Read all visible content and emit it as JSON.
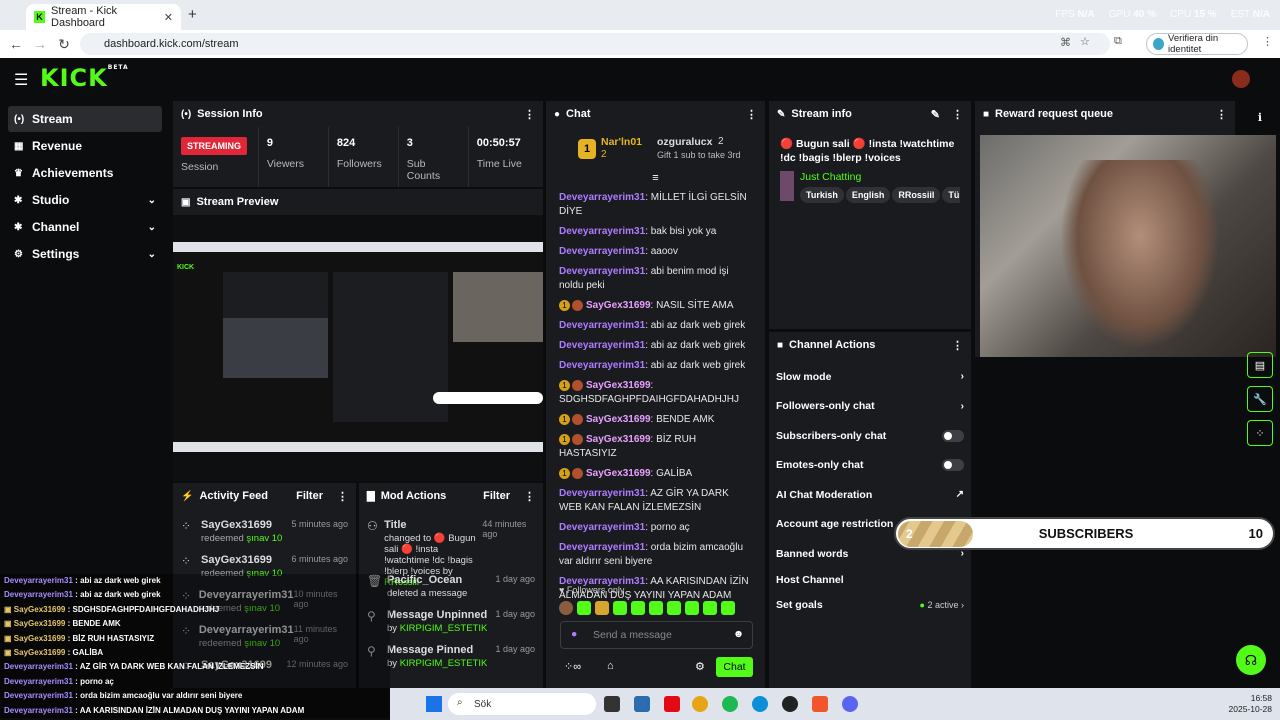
{
  "browser": {
    "tab_title": "Stream - Kick Dashboard",
    "url": "dashboard.kick.com/stream",
    "verify_label": "Verifiera din identitet",
    "perf": {
      "fps_label": "FPS",
      "fps": "N/A",
      "gpu_label": "GPU",
      "gpu": "40 %",
      "cpu_label": "CPU",
      "cpu": "15 %",
      "est_label": "EST",
      "est": "N/A"
    }
  },
  "kick": {
    "logo": "KICK",
    "logo_sup": "BETA"
  },
  "sidebar": {
    "items": [
      {
        "label": "Stream",
        "icon": "(•)"
      },
      {
        "label": "Revenue",
        "icon": "▦"
      },
      {
        "label": "Achievements",
        "icon": "🏆"
      },
      {
        "label": "Studio",
        "icon": "✱"
      },
      {
        "label": "Channel",
        "icon": "✱"
      },
      {
        "label": "Settings",
        "icon": "⚙"
      }
    ]
  },
  "session": {
    "title": "Session Info",
    "status": "STREAMING",
    "status_label": "Session",
    "viewers": "9",
    "viewers_label": "Viewers",
    "followers": "824",
    "followers_label": "Followers",
    "subs": "3",
    "subs_label": "Sub Counts",
    "time": "00:50:57",
    "time_label": "Time Live"
  },
  "preview": {
    "title": "Stream Preview"
  },
  "activity": {
    "title": "Activity Feed",
    "filter": "Filter",
    "items": [
      {
        "name": "SayGex31699",
        "action": "redeemed",
        "reward": "şınav 10",
        "time": "5 minutes ago"
      },
      {
        "name": "SayGex31699",
        "action": "redeemed",
        "reward": "şınav 10",
        "time": "6 minutes ago"
      },
      {
        "name": "Deveyarrayerim31",
        "action": "redeemed",
        "reward": "şınav 10",
        "time": "10 minutes ago"
      },
      {
        "name": "Deveyarrayerim31",
        "action": "redeemed",
        "reward": "şınav 10",
        "time": "11 minutes ago"
      },
      {
        "name": "SayGex31699",
        "action": "",
        "reward": "",
        "time": "12 minutes ago"
      }
    ]
  },
  "mod": {
    "title": "Mod Actions",
    "filter": "Filter",
    "items": [
      {
        "title": "Title",
        "desc": "changed to 🔴 Bugun sali 🔴 !insta !watchtime !dc !bagis !blerp !voices by",
        "by": "RRossiil",
        "time": "44 minutes ago"
      },
      {
        "title": "Pacific_Ocean",
        "desc": "deleted a message",
        "by": "",
        "time": "1 day ago"
      },
      {
        "title": "Message Unpinned",
        "desc": "by",
        "by": "KIRPIGIM_ESTETIK",
        "time": "1 day ago"
      },
      {
        "title": "Message Pinned",
        "desc": "by",
        "by": "KIRPIGIM_ESTETIK",
        "time": "1 day ago"
      }
    ]
  },
  "chat": {
    "title": "Chat",
    "top1_name": "Nar'ln01",
    "top1_count": "2",
    "top2_name": "ozguralucx",
    "top2_count": "2",
    "gift_text": "Gift 1 sub to take 3rd",
    "messages": [
      {
        "user": "Deveyarrayerim31",
        "text": "MİLLET İLGİ GELSİN DİYE",
        "badge": false
      },
      {
        "user": "Deveyarrayerim31",
        "text": "bak bisi yok ya",
        "badge": false
      },
      {
        "user": "Deveyarrayerim31",
        "text": "aaoov",
        "badge": false
      },
      {
        "user": "Deveyarrayerim31",
        "text": "abi benim mod işi noldu peki",
        "badge": false
      },
      {
        "user": "SayGex31699",
        "text": "NASIL SİTE AMA",
        "badge": true
      },
      {
        "user": "Deveyarrayerim31",
        "text": "abi az dark web girek",
        "badge": false
      },
      {
        "user": "Deveyarrayerim31",
        "text": "abi az dark web girek",
        "badge": false
      },
      {
        "user": "Deveyarrayerim31",
        "text": "abi az dark web girek",
        "badge": false
      },
      {
        "user": "SayGex31699",
        "text": "SDGHSDFAGHPFDAIHGFDAHADHJHJ",
        "badge": true
      },
      {
        "user": "SayGex31699",
        "text": "BENDE AMK",
        "badge": true
      },
      {
        "user": "SayGex31699",
        "text": "BİZ RUH HASTASIYIZ",
        "badge": true
      },
      {
        "user": "SayGex31699",
        "text": "GALİBA",
        "badge": true
      },
      {
        "user": "Deveyarrayerim31",
        "text": "AZ GİR YA DARK WEB KAN FALAN İZLEMEZSİN",
        "badge": false
      },
      {
        "user": "Deveyarrayerim31",
        "text": "porno aç",
        "badge": false
      },
      {
        "user": "Deveyarrayerim31",
        "text": "orda bizim amcaoğlu var aldırır seni biyere",
        "badge": false
      },
      {
        "user": "Deveyarrayerim31",
        "text": "AA KARISINDAN İZİN ALMADAN DUŞ YAYINI YAPAN ADAM",
        "badge": false
      }
    ],
    "followers_only": "Followers only",
    "placeholder": "Send a message",
    "send": "Chat"
  },
  "stream_info": {
    "title": "Stream info",
    "stream_title": "🔴 Bugun sali 🔴 !insta !watchtime !dc !bagis !blerp !voices",
    "category": "Just Chatting",
    "tags": [
      "Turkish",
      "English",
      "RRossiil",
      "Türk"
    ]
  },
  "channel_actions": {
    "title": "Channel Actions",
    "items": [
      {
        "label": "Slow mode",
        "ctrl": "chev"
      },
      {
        "label": "Followers-only chat",
        "ctrl": "chev"
      },
      {
        "label": "Subscribers-only chat",
        "ctrl": "toggle"
      },
      {
        "label": "Emotes-only chat",
        "ctrl": "toggle"
      },
      {
        "label": "AI Chat Moderation",
        "ctrl": "ext"
      },
      {
        "label": "Account age restriction",
        "ctrl": ""
      },
      {
        "label": "Banned words",
        "ctrl": "chev"
      },
      {
        "label": "Host Channel",
        "ctrl": ""
      },
      {
        "label": "Set goals",
        "ctrl": "chev"
      }
    ],
    "goals_active": "2 active"
  },
  "reward": {
    "title": "Reward request queue"
  },
  "subs_overlay": {
    "current": "2",
    "label": "SUBSCRIBERS",
    "goal": "10",
    "progress": 0.2
  },
  "ghost": [
    {
      "user": "Deveyarrayerim31",
      "text": "abi az dark web girek",
      "badge": false
    },
    {
      "user": "Deveyarrayerim31",
      "text": "abi az dark web girek",
      "badge": false
    },
    {
      "user": "SayGex31699",
      "text": "SDGHSDFAGHPFDAIHGFDAHADHJHJ",
      "badge": true
    },
    {
      "user": "SayGex31699",
      "text": "BENDE AMK",
      "badge": true
    },
    {
      "user": "SayGex31699",
      "text": "BİZ RUH HASTASIYIZ",
      "badge": true
    },
    {
      "user": "SayGex31699",
      "text": "GALİBA",
      "badge": true
    },
    {
      "user": "Deveyarrayerim31",
      "text": "AZ GİR YA DARK WEB KAN FALAN İZLEMEZSİN",
      "badge": false
    },
    {
      "user": "Deveyarrayerim31",
      "text": "porno aç",
      "badge": false
    },
    {
      "user": "Deveyarrayerim31",
      "text": "orda bizim amcaoğlu var aldırır seni biyere",
      "badge": false
    },
    {
      "user": "Deveyarrayerim31",
      "text": "AA KARISINDAN İZİN ALMADAN DUŞ YAYINI YAPAN ADAM",
      "badge": false
    }
  ],
  "taskbar": {
    "search": "Sök",
    "time": "16:58",
    "date": "2025-10-28"
  }
}
